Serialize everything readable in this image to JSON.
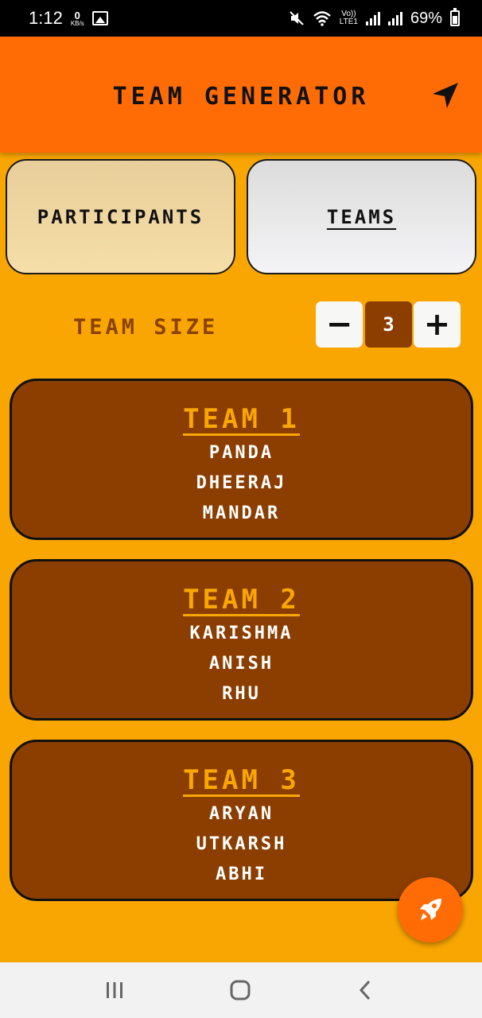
{
  "status_bar": {
    "time": "1:12",
    "net_speed_value": "0",
    "net_speed_unit": "KB/s",
    "volte_top": "Vo))",
    "volte_bottom": "LTE1",
    "battery": "69%",
    "icons": [
      "image-icon",
      "mute-icon",
      "wifi-icon",
      "signal-icon",
      "battery-icon"
    ]
  },
  "app_bar": {
    "title": "TEAM GENERATOR",
    "action_icon": "navigation-arrow-icon",
    "color": "#FF6C06"
  },
  "tabs": [
    {
      "label": "PARTICIPANTS",
      "selected": false
    },
    {
      "label": "TEAMS",
      "selected": true
    }
  ],
  "team_size": {
    "label": "TEAM SIZE",
    "decrement_label": "−",
    "increment_label": "+",
    "value": "3"
  },
  "teams": [
    {
      "title": "TEAM 1",
      "members": [
        "PANDA",
        "DHEERAJ",
        "MANDAR"
      ]
    },
    {
      "title": "TEAM 2",
      "members": [
        "KARISHMA",
        "ANISH",
        "RHU"
      ]
    },
    {
      "title": "TEAM 3",
      "members": [
        "ARYAN",
        "UTKARSH",
        "ABHI"
      ]
    }
  ],
  "fab": {
    "icon": "rocket-icon"
  },
  "colors": {
    "background": "#F9A602",
    "card": "#8B3E00",
    "accent": "#FF6C06"
  }
}
